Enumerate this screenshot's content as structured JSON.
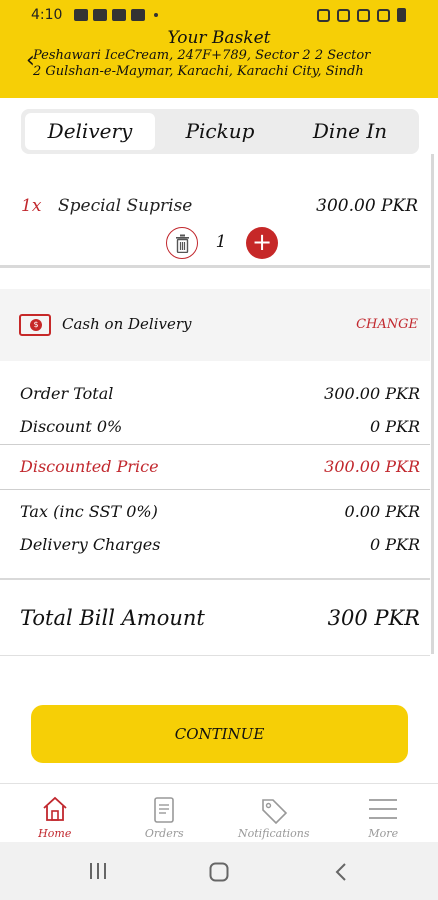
{
  "status_bar": {
    "time": "4:10"
  },
  "header": {
    "title": "Your Basket",
    "address": "Peshawari IceCream, 247F+789, Sector 2 2 Sector 2 Gulshan-e-Maymar, Karachi, Karachi City, Sindh"
  },
  "tabs": [
    {
      "label": "Delivery",
      "active": true
    },
    {
      "label": "Pickup",
      "active": false
    },
    {
      "label": "Dine In",
      "active": false
    }
  ],
  "item": {
    "qty_label": "1x",
    "name": "Special Suprise",
    "price": "300.00 PKR",
    "stepper_value": "1"
  },
  "payment": {
    "method": "Cash on Delivery",
    "change_label": "CHANGE"
  },
  "summary": {
    "order_total_label": "Order Total",
    "order_total_value": "300.00 PKR",
    "discount_label": "Discount 0%",
    "discount_value": "0 PKR",
    "discounted_label": "Discounted Price",
    "discounted_value": "300.00 PKR",
    "tax_label": "Tax (inc SST 0%)",
    "tax_value": "0.00 PKR",
    "delivery_label": "Delivery Charges",
    "delivery_value": "0 PKR"
  },
  "total": {
    "label": "Total Bill Amount",
    "value": "300 PKR"
  },
  "continue_label": "CONTINUE",
  "bottom_nav": [
    {
      "label": "Home",
      "icon": "home-icon",
      "active": true
    },
    {
      "label": "Orders",
      "icon": "orders-icon",
      "active": false
    },
    {
      "label": "Notifications",
      "icon": "tag-icon",
      "active": false
    },
    {
      "label": "More",
      "icon": "menu-icon",
      "active": false
    }
  ],
  "colors": {
    "brand_yellow": "#f6cf06",
    "accent_red": "#c1272d"
  }
}
